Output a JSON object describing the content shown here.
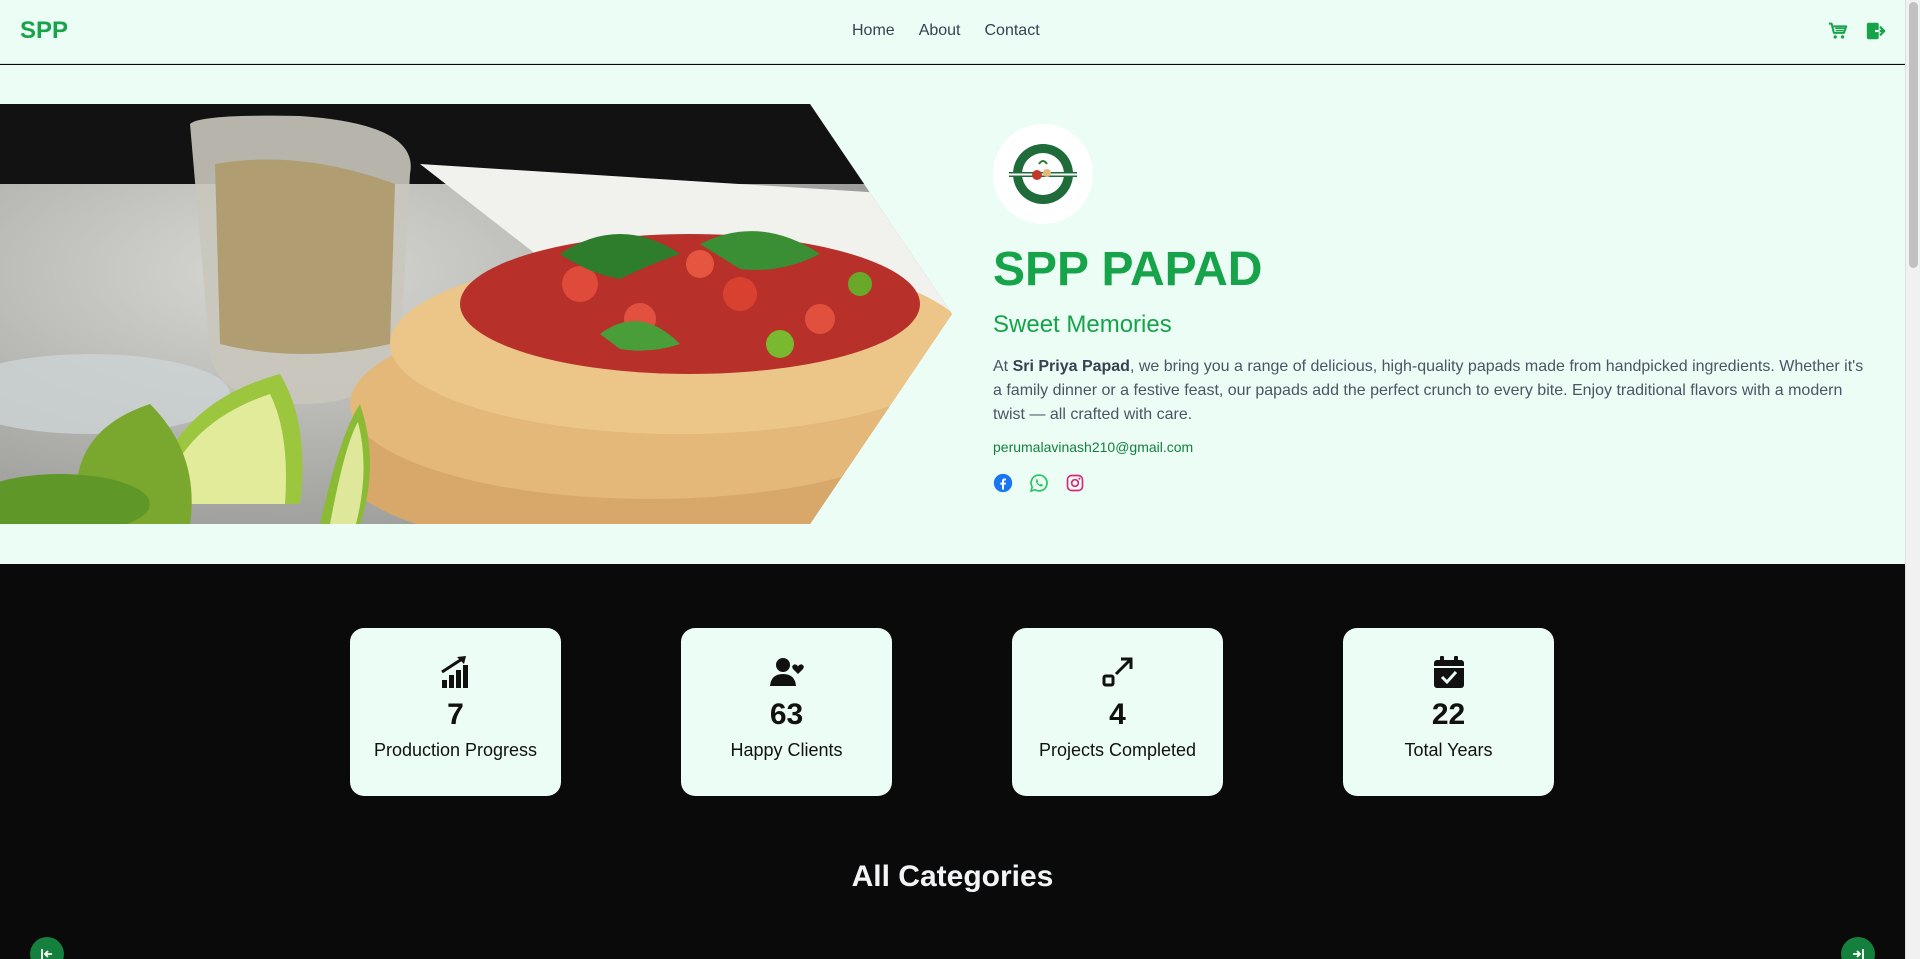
{
  "nav": {
    "brand": "SPP",
    "links": [
      "Home",
      "About",
      "Contact"
    ],
    "icons": [
      "cart-icon",
      "logout-icon"
    ]
  },
  "hero": {
    "title": "SPP PAPAD",
    "subtitle": "Sweet Memories",
    "desc_prefix": "At ",
    "desc_bold": "Sri Priya Papad",
    "desc_suffix": ", we bring you a range of delicious, high-quality papads made from handpicked ingredients. Whether it's a family dinner or a festive feast, our papads add the perfect crunch to every bite. Enjoy traditional flavors with a modern twist — all crafted with care.",
    "email": "perumalavinash210@gmail.com",
    "socials": [
      "facebook-icon",
      "whatsapp-icon",
      "instagram-icon"
    ]
  },
  "stats": [
    {
      "value": "7",
      "label": "Production Progress",
      "icon": "chart-growth-icon"
    },
    {
      "value": "63",
      "label": "Happy Clients",
      "icon": "user-heart-icon"
    },
    {
      "value": "4",
      "label": "Projects Completed",
      "icon": "expand-arrow-icon"
    },
    {
      "value": "22",
      "label": "Total Years",
      "icon": "calendar-check-icon"
    }
  ],
  "categories": {
    "title": "All Categories"
  },
  "colors": {
    "brand_green": "#16a34a",
    "hero_bg": "#ecfdf5",
    "dark_bg": "#0a0a0a"
  }
}
